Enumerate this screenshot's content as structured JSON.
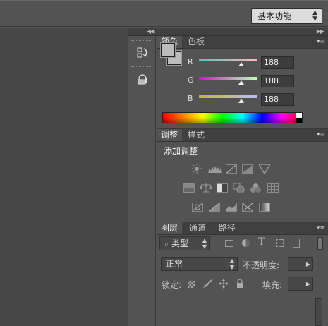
{
  "toolbar": {
    "workspace_label": "基本功能"
  },
  "color_panel": {
    "tabs": [
      "颜色",
      "色板"
    ],
    "channels": [
      {
        "label": "R",
        "value": "188",
        "level": 0.737
      },
      {
        "label": "G",
        "value": "188",
        "level": 0.737
      },
      {
        "label": "B",
        "value": "188",
        "level": 0.737
      }
    ],
    "foreground": "#bcbcbc",
    "background": "#bcbcbc"
  },
  "adjust_panel": {
    "tabs": [
      "调整",
      "样式"
    ],
    "title": "添加调整",
    "icons": [
      [
        "brightness-contrast-icon",
        "levels-icon",
        "curves-icon",
        "exposure-icon",
        "vibrance-icon"
      ],
      [
        "hue-saturation-icon",
        "color-balance-icon",
        "black-white-icon",
        "photo-filter-icon",
        "channel-mixer-icon",
        "color-lookup-icon"
      ],
      [
        "invert-icon",
        "posterize-icon",
        "threshold-icon",
        "selective-color-icon",
        "gradient-map-icon"
      ]
    ]
  },
  "layers_panel": {
    "tabs": [
      "图层",
      "通道",
      "路径"
    ],
    "kind_label": "类型",
    "blend_mode": "正常",
    "opacity_label": "不透明度:",
    "lock_label": "锁定:",
    "fill_label": "填充:"
  }
}
